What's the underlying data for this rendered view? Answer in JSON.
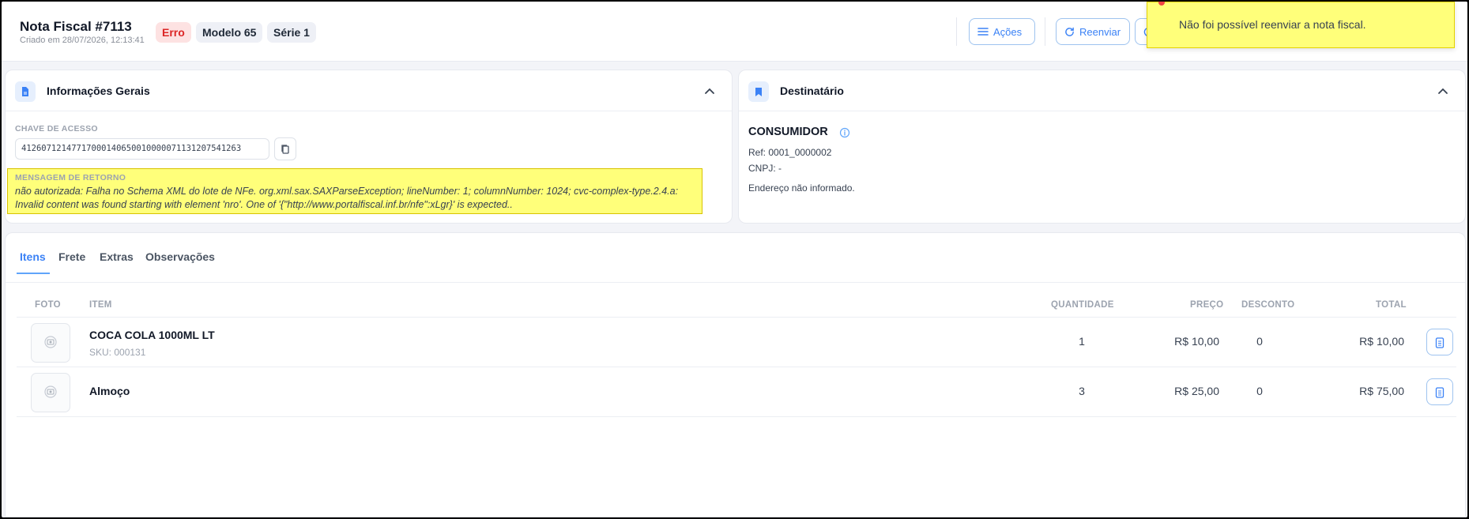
{
  "header": {
    "title": "Nota Fiscal #7113",
    "created": "Criado em 28/07/2026, 12:13:41",
    "badges": {
      "status": "Erro",
      "modelo": "Modelo 65",
      "serie": "Série 1"
    },
    "actions_label": "Ações",
    "reenviar_label": "Reenviar"
  },
  "toast": {
    "message": "Não foi possível reenviar a nota fiscal."
  },
  "info_card": {
    "title": "Informações Gerais",
    "chave_label": "CHAVE DE ACESSO",
    "chave_value": "41260712147717000140650010000071131207541263",
    "mensagem_label": "MENSAGEM DE RETORNO",
    "mensagem_text": "não autorizada: Falha no Schema XML do lote de NFe. org.xml.sax.SAXParseException; lineNumber: 1; columnNumber: 1024; cvc-complex-type.2.4.a: Invalid content was found starting with element 'nro'. One of '{\"http://www.portalfiscal.inf.br/nfe\":xLgr}' is expected.."
  },
  "dest_card": {
    "title": "Destinatário",
    "name": "CONSUMIDOR",
    "ref": "Ref: 0001_0000002",
    "cnpj": "CNPJ: -",
    "endereco": "Endereço não informado."
  },
  "tabs": [
    "Itens",
    "Frete",
    "Extras",
    "Observações"
  ],
  "table": {
    "headers": {
      "foto": "FOTO",
      "item": "ITEM",
      "quantidade": "QUANTIDADE",
      "preco": "PREÇO",
      "desconto": "DESCONTO",
      "total": "TOTAL"
    },
    "rows": [
      {
        "name": "COCA COLA 1000ML LT",
        "sku": "SKU: 000131",
        "qty": "1",
        "price": "R$ 10,00",
        "desc": "0",
        "total": "R$ 10,00"
      },
      {
        "name": "Almoço",
        "sku": "",
        "qty": "3",
        "price": "R$ 25,00",
        "desc": "0",
        "total": "R$ 75,00"
      }
    ]
  },
  "colors": {
    "accent": "#3b82f6",
    "error_bg": "#fde2e2",
    "error_text": "#dc2626",
    "highlight": "#ffff7a"
  }
}
